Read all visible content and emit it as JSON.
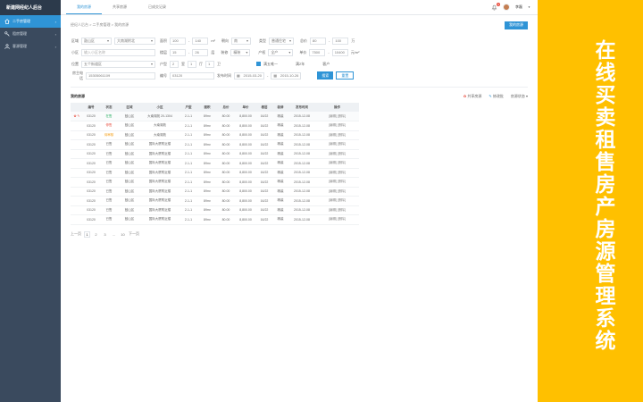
{
  "sidebar": {
    "brand": "新建网经纪人后台",
    "items": [
      {
        "label": "二手房管理"
      },
      {
        "label": "租房管理"
      },
      {
        "label": "客源管理"
      }
    ]
  },
  "topbar": {
    "tabs": [
      {
        "label": "我的房源"
      },
      {
        "label": "共享房源"
      },
      {
        "label": "已成交记录"
      }
    ],
    "notification_count": "3",
    "user_name": "李磊"
  },
  "breadcrumb": "经纪人后台 > 二手房管理 > 我的房源",
  "add_button": "我的房源",
  "filters": {
    "row1": {
      "region_label": "区域",
      "region_value": "鼓山区",
      "subregion_value": "大南湖附北",
      "area_label": "面积",
      "area_min": "100",
      "area_max": "140",
      "area_unit": "m²",
      "orient_label": "朝向",
      "orient_value": "南",
      "type_label": "类型",
      "type_value": "普通住宅",
      "price_label": "总价",
      "price_min": "80",
      "price_max": "100",
      "price_unit": "万"
    },
    "row2": {
      "community_label": "小区",
      "community_placeholder": "输入小区名称",
      "floor_label": "楼层",
      "floor_min": "15",
      "floor_max": "26",
      "floor_unit": "层",
      "decor_label": "装修",
      "decor_value": "精装",
      "prop_label": "产权",
      "prop_value": "全产",
      "unit_label": "单价",
      "unit_min": "7500",
      "unit_max": "10400",
      "unit_unit": "元/m²"
    },
    "row3": {
      "addr_label": "位置",
      "addr_value": "五个街道区",
      "layout_label": "户型",
      "layout_a": "2",
      "layout_a_unit": "室",
      "layout_b": "1",
      "layout_b_unit": "厅",
      "layout_c": "1",
      "layout_c_unit": "卫",
      "check_label": "满五唯一",
      "floor_no_label": "满2年",
      "owner_label": "客户"
    },
    "row4": {
      "phone_label": "房主电话",
      "phone_value": "15305061109",
      "code_label": "编号",
      "code_value": "03120",
      "date_label": "发布时间",
      "date_from": "2015-03-20",
      "date_to": "2015-10-26",
      "search_label": "搜索",
      "reset_label": "重置"
    }
  },
  "list": {
    "title": "我的房源",
    "action_share": "共享房源",
    "action_edit": "修改批",
    "action_sort": "房源状态",
    "columns": [
      "",
      "编号",
      "状态",
      "区域",
      "小区",
      "户型",
      "面积",
      "总价",
      "单价",
      "楼层",
      "装修",
      "发布时间",
      "操作"
    ],
    "rows": [
      {
        "mark": "✿ ✎",
        "code": "03120",
        "status": "在售",
        "region": "鼓山区",
        "community": "大南湖苑 20-1304",
        "layout": "2-1-1",
        "area": "89m²",
        "total": "80.00",
        "unit": "8,800.00",
        "floor": "16/22",
        "decor": "精装",
        "date": "2015-12-08",
        "ops": "[编辑] [删除]"
      },
      {
        "mark": "",
        "code": "03120",
        "status": "停售",
        "region": "鼓山区",
        "community": "大南湖苑",
        "layout": "2-1-1",
        "area": "89m²",
        "total": "80.00",
        "unit": "8,800.00",
        "floor": "16/22",
        "decor": "精装",
        "date": "2015-12-08",
        "ops": "[编辑] [删除]"
      },
      {
        "mark": "",
        "code": "03120",
        "status": "待审核",
        "region": "鼓山区",
        "community": "大南湖苑",
        "layout": "2-1-1",
        "area": "89m²",
        "total": "80.00",
        "unit": "8,800.00",
        "floor": "16/22",
        "decor": "精装",
        "date": "2015-12-08",
        "ops": "[编辑] [删除]"
      },
      {
        "mark": "",
        "code": "03120",
        "status": "已售",
        "region": "鼓山区",
        "community": "国际大厦附近楼",
        "layout": "2-1-1",
        "area": "89m²",
        "total": "80.00",
        "unit": "8,800.00",
        "floor": "16/22",
        "decor": "精装",
        "date": "2015-12-08",
        "ops": "[编辑] [删除]"
      },
      {
        "mark": "",
        "code": "03120",
        "status": "已售",
        "region": "鼓山区",
        "community": "国际大厦附近楼",
        "layout": "2-1-1",
        "area": "89m²",
        "total": "80.00",
        "unit": "8,800.00",
        "floor": "16/22",
        "decor": "精装",
        "date": "2015-12-08",
        "ops": "[编辑] [删除]"
      },
      {
        "mark": "",
        "code": "03120",
        "status": "已售",
        "region": "鼓山区",
        "community": "国际大厦附近楼",
        "layout": "2-1-1",
        "area": "89m²",
        "total": "80.00",
        "unit": "8,800.00",
        "floor": "16/22",
        "decor": "精装",
        "date": "2015-12-08",
        "ops": "[编辑] [删除]"
      },
      {
        "mark": "",
        "code": "03120",
        "status": "已售",
        "region": "鼓山区",
        "community": "国际大厦附近楼",
        "layout": "2-1-1",
        "area": "89m²",
        "total": "80.00",
        "unit": "8,800.00",
        "floor": "16/22",
        "decor": "精装",
        "date": "2015-12-08",
        "ops": "[编辑] [删除]"
      },
      {
        "mark": "",
        "code": "03120",
        "status": "已售",
        "region": "鼓山区",
        "community": "国际大厦附近楼",
        "layout": "2-1-1",
        "area": "89m²",
        "total": "80.00",
        "unit": "8,800.00",
        "floor": "16/22",
        "decor": "精装",
        "date": "2015-12-08",
        "ops": "[编辑] [删除]"
      },
      {
        "mark": "",
        "code": "03120",
        "status": "已售",
        "region": "鼓山区",
        "community": "国际大厦附近楼",
        "layout": "2-1-1",
        "area": "89m²",
        "total": "80.00",
        "unit": "8,800.00",
        "floor": "16/22",
        "decor": "精装",
        "date": "2015-12-08",
        "ops": "[编辑] [删除]"
      },
      {
        "mark": "",
        "code": "03120",
        "status": "已售",
        "region": "鼓山区",
        "community": "国际大厦附近楼",
        "layout": "2-1-1",
        "area": "89m²",
        "total": "80.00",
        "unit": "8,800.00",
        "floor": "16/22",
        "decor": "精装",
        "date": "2015-12-08",
        "ops": "[编辑] [删除]"
      },
      {
        "mark": "",
        "code": "03120",
        "status": "已售",
        "region": "鼓山区",
        "community": "国际大厦附近楼",
        "layout": "2-1-1",
        "area": "89m²",
        "total": "80.00",
        "unit": "8,800.00",
        "floor": "16/22",
        "decor": "精装",
        "date": "2015-12-08",
        "ops": "[编辑] [删除]"
      },
      {
        "mark": "",
        "code": "03120",
        "status": "已售",
        "region": "鼓山区",
        "community": "国际大厦附近楼",
        "layout": "2-1-1",
        "area": "89m²",
        "total": "80.00",
        "unit": "8,800.00",
        "floor": "16/22",
        "decor": "精装",
        "date": "2015-12-08",
        "ops": "[编辑] [删除]"
      }
    ]
  },
  "pager": {
    "prev": "上一页",
    "pages": [
      "1",
      "2",
      "3",
      "…",
      "10"
    ],
    "next": "下一页"
  },
  "promo": {
    "text": "在线买卖租售房产房源管理系统"
  },
  "colors": {
    "accent": "#2f94d6",
    "sidebar": "#3a4a5e",
    "promo": "#ffc000"
  }
}
